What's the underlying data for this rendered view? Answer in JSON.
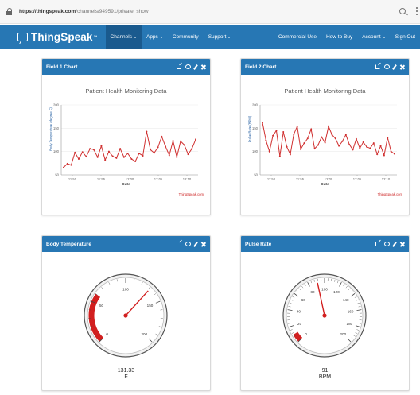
{
  "browser": {
    "url_host": "https://thingspeak.com",
    "url_path": "/channels/949591/private_show"
  },
  "nav": {
    "brand": "ThingSpeak",
    "brand_mark": "™",
    "items": [
      {
        "label": "Channels",
        "has_caret": true,
        "active": true
      },
      {
        "label": "Apps",
        "has_caret": true,
        "active": false
      },
      {
        "label": "Community",
        "has_caret": false,
        "active": false
      },
      {
        "label": "Support",
        "has_caret": true,
        "active": false
      }
    ],
    "right_items": [
      {
        "label": "Commercial Use",
        "has_caret": false
      },
      {
        "label": "How to Buy",
        "has_caret": false
      },
      {
        "label": "Account",
        "has_caret": true
      },
      {
        "label": "Sign Out",
        "has_caret": false
      }
    ]
  },
  "panels": {
    "field1": {
      "title": "Field 1 Chart",
      "chart_data": {
        "type": "line",
        "title": "Patient Health Monitoring Data",
        "xlabel": "Date",
        "ylabel": "Body Temperature (degree F)",
        "yticks": [
          "200",
          "150",
          "100",
          "50"
        ],
        "xticks": [
          "11:50",
          "11:55",
          "12:00",
          "12:05",
          "12:10"
        ],
        "ylim": [
          50,
          200
        ],
        "credit": "ThingSpeak.com",
        "color": "#d03030",
        "values": [
          66,
          74,
          71,
          98,
          84,
          99,
          89,
          106,
          104,
          88,
          112,
          82,
          100,
          90,
          86,
          106,
          88,
          96,
          84,
          79,
          96,
          91,
          143,
          104,
          97,
          109,
          132,
          111,
          92,
          123,
          88,
          122,
          114,
          94,
          106,
          126
        ]
      }
    },
    "field2": {
      "title": "Field 2 Chart",
      "chart_data": {
        "type": "line",
        "title": "Patient Health Monitoring Data",
        "xlabel": "Date",
        "ylabel": "Pulse Rate (BPM)",
        "yticks": [
          "200",
          "150",
          "100",
          "50"
        ],
        "xticks": [
          "11:50",
          "11:55",
          "12:00",
          "12:05",
          "12:10"
        ],
        "ylim": [
          50,
          200
        ],
        "credit": "ThingSpeak.com",
        "color": "#d03030",
        "values": [
          162,
          124,
          100,
          134,
          145,
          90,
          142,
          110,
          94,
          137,
          154,
          105,
          118,
          128,
          148,
          106,
          114,
          131,
          119,
          154,
          136,
          128,
          112,
          122,
          136,
          115,
          104,
          127,
          107,
          120,
          110,
          107,
          118,
          94,
          112,
          92,
          130,
          100,
          95
        ]
      }
    },
    "temp": {
      "title": "Body Temperature",
      "value": "131.33",
      "unit": "F",
      "min": 0,
      "max": 200,
      "needle_value": 131.33,
      "red_from": 0,
      "red_to": 60,
      "labels": [
        "0",
        "50",
        "100",
        "150",
        "200"
      ]
    },
    "pulse": {
      "title": "Pulse Rate",
      "value": "91",
      "unit": "BPM",
      "min": 0,
      "max": 200,
      "needle_value": 91,
      "red_from": 0,
      "red_to": 10,
      "labels": [
        "0",
        "20",
        "40",
        "60",
        "80",
        "100",
        "120",
        "140",
        "160",
        "180",
        "200"
      ]
    }
  }
}
